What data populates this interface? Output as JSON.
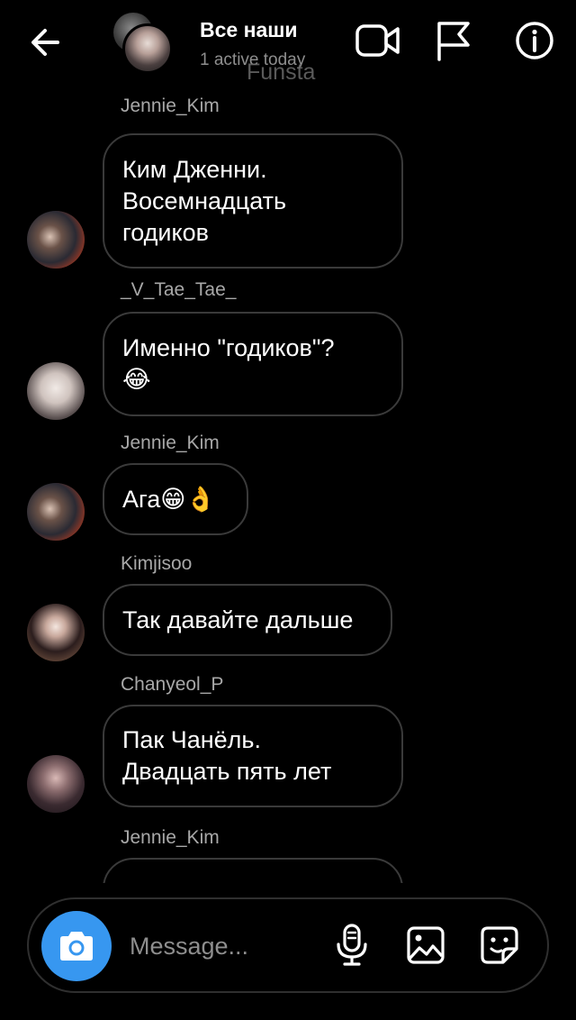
{
  "header": {
    "title": "Все наши",
    "subtitle": "1 active today",
    "watermark": "Funsta"
  },
  "messages": [
    {
      "sender": "Jennie_Kim",
      "text_lines": [
        "Ким Дженни.",
        "Восемнадцать",
        "годиков"
      ]
    },
    {
      "sender": "_V_Tae_Tae_",
      "text_lines": [
        "Именно \"годиков\"?",
        "😂"
      ]
    },
    {
      "sender": "Jennie_Kim",
      "text_lines": [
        "Ага😁👌"
      ]
    },
    {
      "sender": "Kimjisoo",
      "text_lines": [
        "Так давайте дальше"
      ]
    },
    {
      "sender": "Chanyeol_P",
      "text_lines": [
        "Пак Чанёль.",
        "Двадцать пять лет"
      ]
    },
    {
      "sender": "Jennie_Kim",
      "text_lines": [
        ""
      ]
    }
  ],
  "composer": {
    "placeholder": "Message..."
  },
  "colors": {
    "background": "#000000",
    "accent": "#3797f0",
    "bubble_border": "#3a3a3a",
    "muted_text": "#8e8e8e"
  },
  "icons": {
    "back": "back-arrow-icon",
    "video": "video-camera-icon",
    "flag": "flag-icon",
    "info": "info-icon",
    "camera": "camera-icon",
    "mic": "microphone-icon",
    "gallery": "image-gallery-icon",
    "sticker": "sticker-icon"
  }
}
